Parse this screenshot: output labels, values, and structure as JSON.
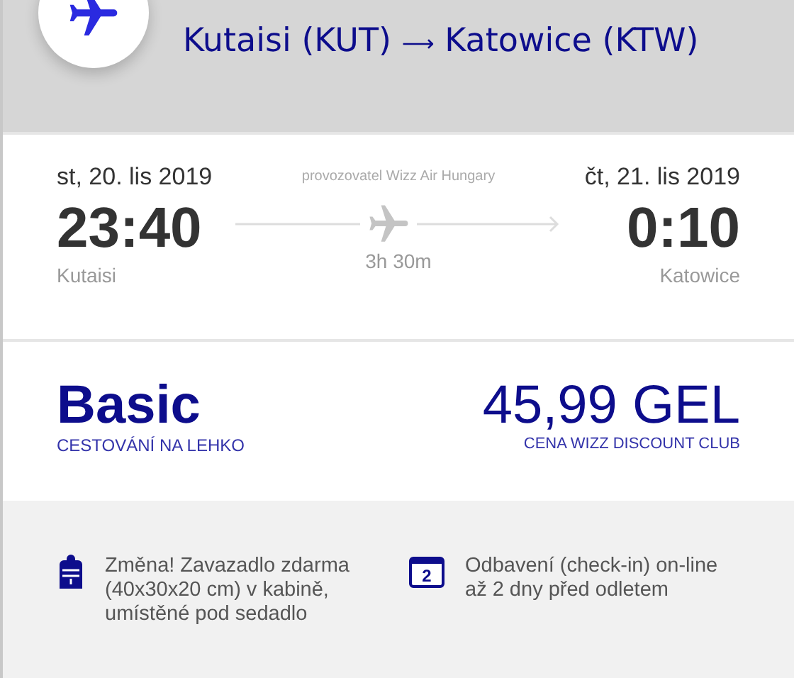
{
  "route": {
    "from": "Kutaisi (KUT)",
    "arrow": "⟶",
    "to": "Katowice (KTW)"
  },
  "flight": {
    "departure": {
      "date": "st, 20. lis 2019",
      "time": "23:40",
      "city": "Kutaisi"
    },
    "operator": "provozovatel Wizz Air Hungary",
    "duration": "3h 30m",
    "arrival": {
      "date": "čt, 21. lis 2019",
      "time": "0:10",
      "city": "Katowice"
    }
  },
  "fare": {
    "name": "Basic",
    "subtitle": "CESTOVÁNÍ NA LEHKO",
    "price": "45,99 GEL",
    "price_note": "CENA WIZZ DISCOUNT CLUB"
  },
  "features": [
    {
      "kind": "bag",
      "text": "Změna! Zavazadlo zdarma (40x30x20 cm) v kabině, umístěné pod sedadlo"
    },
    {
      "kind": "calendar",
      "icon_text": "2",
      "text": "Odbavení (check-in) on-line až 2 dny před odletem"
    }
  ]
}
